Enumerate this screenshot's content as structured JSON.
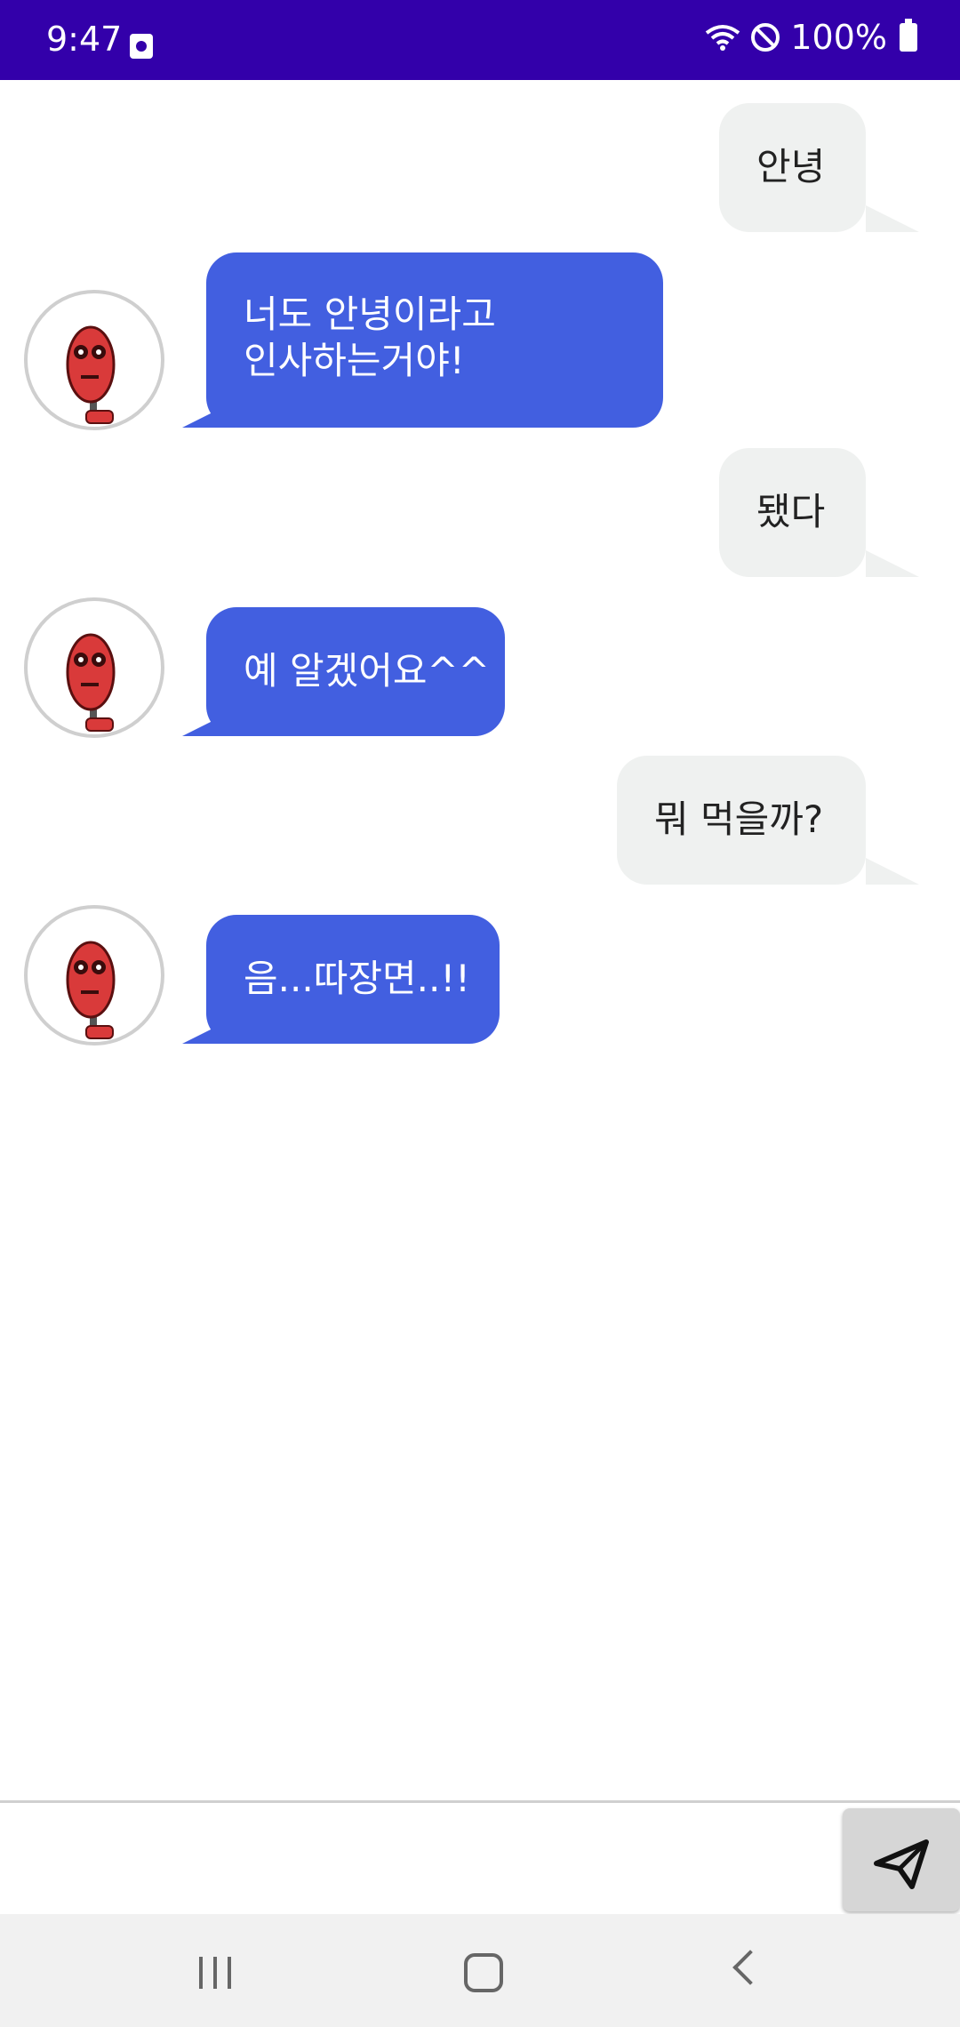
{
  "status_bar": {
    "time": "9:47",
    "battery": "100%",
    "icons": [
      "notification-app-icon",
      "wifi-icon",
      "do-not-disturb-icon",
      "battery-icon"
    ],
    "background_color": "#3300aa"
  },
  "chat": {
    "messages": [
      {
        "side": "sent",
        "text": "안녕"
      },
      {
        "side": "received",
        "text": "너도 안녕이라고\n인사하는거야!"
      },
      {
        "side": "sent",
        "text": "됐다"
      },
      {
        "side": "received",
        "text": "예 알겠어요^^"
      },
      {
        "side": "sent",
        "text": "뭐 먹을까?"
      },
      {
        "side": "received",
        "text": "음...따장면..!!"
      }
    ],
    "sent_bubble_color": "#eff1f0",
    "received_bubble_color": "#425fe0"
  },
  "composer": {
    "input_value": "",
    "send_icon": "send-paper-plane-icon"
  },
  "nav_bar": {
    "icons": [
      "recent-apps-icon",
      "home-icon",
      "back-icon"
    ]
  }
}
